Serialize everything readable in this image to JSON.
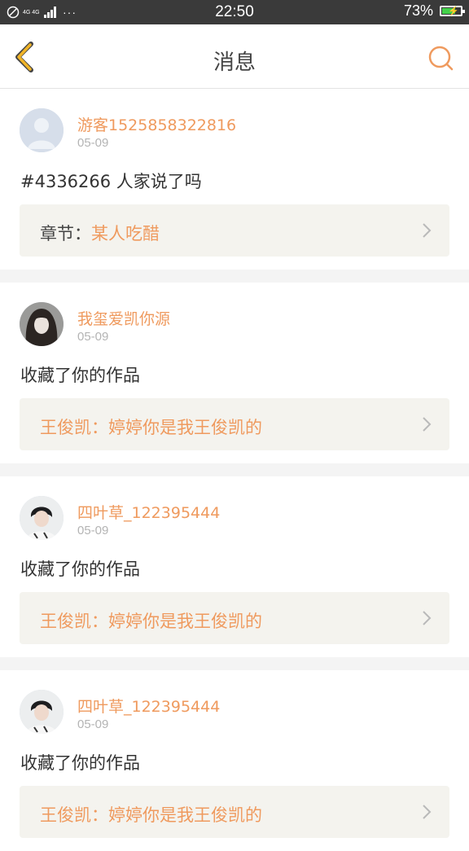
{
  "status_bar": {
    "network_label": "4G 4G",
    "dots": "···",
    "time": "22:50",
    "battery": "73%",
    "battery_level": 0.73
  },
  "header": {
    "title": "消息",
    "back_icon": "chevron-left-icon",
    "search_icon": "search-icon"
  },
  "colors": {
    "accent": "#ef9a5e",
    "back_icon": "#f0b428",
    "card_ref_bg": "#f4f3ee"
  },
  "messages": [
    {
      "username": "游客1525858322816",
      "date": "05-09",
      "text": "#4336266 人家说了吗",
      "ref_prefix": "章节：",
      "ref_title": "某人吃醋",
      "avatar": "default-avatar"
    },
    {
      "username": "我玺爱凯你源",
      "date": "05-09",
      "text": "收藏了你的作品",
      "ref_prefix": "",
      "ref_title": "王俊凯：婷婷你是我王俊凯的",
      "avatar": "photo-avatar"
    },
    {
      "username": "四叶草_122395444",
      "date": "05-09",
      "text": "收藏了你的作品",
      "ref_prefix": "",
      "ref_title": "王俊凯：婷婷你是我王俊凯的",
      "avatar": "photo-avatar"
    },
    {
      "username": "四叶草_122395444",
      "date": "05-09",
      "text": "收藏了你的作品",
      "ref_prefix": "",
      "ref_title": "王俊凯：婷婷你是我王俊凯的",
      "avatar": "photo-avatar"
    }
  ]
}
